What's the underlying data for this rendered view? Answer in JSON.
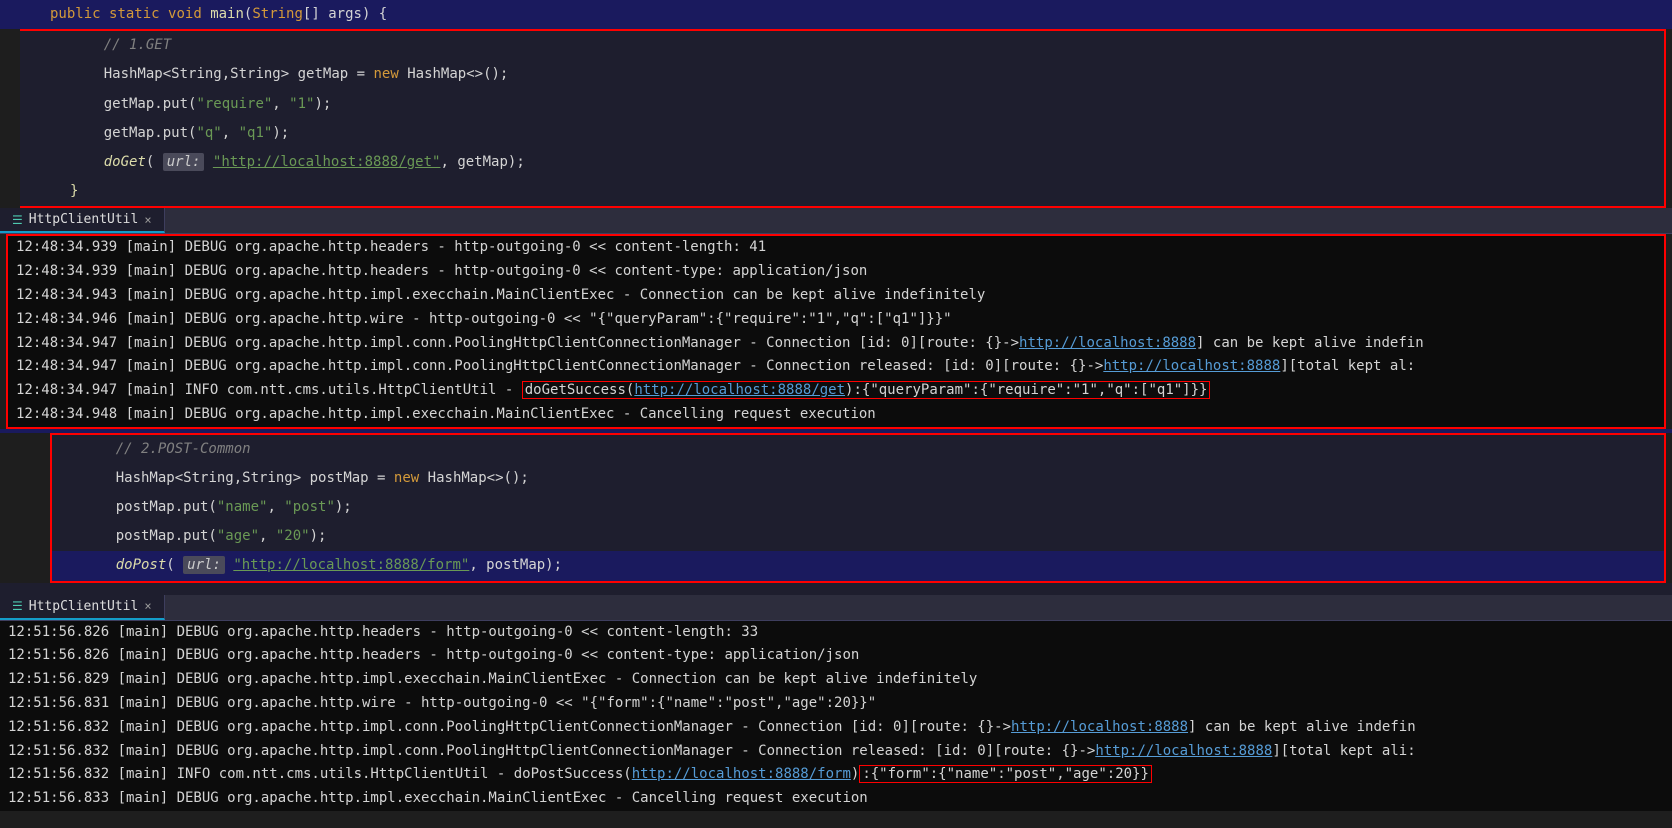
{
  "labels": {
    "get": "GET",
    "postCommon": "POST-common"
  },
  "tabs": {
    "tab1": "HttpClientUtil",
    "tab2": "HttpClientUtil"
  },
  "code": {
    "sig_public": "public",
    "sig_static": "static",
    "sig_void": "void",
    "sig_main": "main",
    "sig_string": "String",
    "sig_args": "[] args",
    "comment_get": "// 1.GET",
    "type_hashmap": "HashMap",
    "type_generics": "<String,String>",
    "var_getmap": "getMap",
    "kw_new": "new",
    "hashmap_ctor": "HashMap<>();",
    "put_require_key": "\"require\"",
    "put_require_val": "\"1\"",
    "put_q_key": "\"q\"",
    "put_q_val": "\"q1\"",
    "doget": "doGet",
    "url_label": "url:",
    "url_get": "\"http://localhost:8888/get\"",
    "comment_post": "// 2.POST-Common",
    "var_postmap": "postMap",
    "put_name_key": "\"name\"",
    "put_name_val": "\"post\"",
    "put_age_key": "\"age\"",
    "put_age_val": "\"20\"",
    "dopost": "doPost",
    "url_post": "\"http://localhost:8888/form\""
  },
  "console1": {
    "l1": "12:48:34.939 [main] DEBUG org.apache.http.headers - http-outgoing-0 << content-length: 41",
    "l2": "12:48:34.939 [main] DEBUG org.apache.http.headers - http-outgoing-0 << content-type: application/json",
    "l3": "12:48:34.943 [main] DEBUG org.apache.http.impl.execchain.MainClientExec - Connection can be kept alive indefinitely",
    "l4": "12:48:34.946 [main] DEBUG org.apache.http.wire - http-outgoing-0 << \"{\"queryParam\":{\"require\":\"1\",\"q\":[\"q1\"]}}\"",
    "l5a": "12:48:34.947 [main] DEBUG org.apache.http.impl.conn.PoolingHttpClientConnectionManager - Connection [id: 0][route: {}->",
    "l5link": "http://localhost:8888",
    "l5b": "] can be kept alive indefin",
    "l6a": "12:48:34.947 [main] DEBUG org.apache.http.impl.conn.PoolingHttpClientConnectionManager - Connection released: [id: 0][route: {}->",
    "l6link": "http://localhost:8888",
    "l6b": "][total kept al:",
    "l7a": "12:48:34.947 [main] INFO com.ntt.cms.utils.HttpClientUtil - ",
    "l7hb_a": "doGetSuccess(",
    "l7hb_link": "http://localhost:8888/get",
    "l7hb_b": "):{\"queryParam\":{\"require\":\"1\",\"q\":[\"q1\"]}}",
    "l8": "12:48:34.948 [main] DEBUG org.apache.http.impl.execchain.MainClientExec - Cancelling request execution"
  },
  "console2": {
    "l1": "12:51:56.826 [main] DEBUG org.apache.http.headers - http-outgoing-0 << content-length: 33",
    "l2": "12:51:56.826 [main] DEBUG org.apache.http.headers - http-outgoing-0 << content-type: application/json",
    "l3": "12:51:56.829 [main] DEBUG org.apache.http.impl.execchain.MainClientExec - Connection can be kept alive indefinitely",
    "l4": "12:51:56.831 [main] DEBUG org.apache.http.wire - http-outgoing-0 << \"{\"form\":{\"name\":\"post\",\"age\":20}}\"",
    "l5a": "12:51:56.832 [main] DEBUG org.apache.http.impl.conn.PoolingHttpClientConnectionManager - Connection [id: 0][route: {}->",
    "l5link": "http://localhost:8888",
    "l5b": "] can be kept alive indefin",
    "l6a": "12:51:56.832 [main] DEBUG org.apache.http.impl.conn.PoolingHttpClientConnectionManager - Connection released: [id: 0][route: {}->",
    "l6link": "http://localhost:8888",
    "l6b": "][total kept ali:",
    "l7a": "12:51:56.832 [main] INFO com.ntt.cms.utils.HttpClientUtil - doPostSuccess(",
    "l7link": "http://localhost:8888/form",
    "l7b": ")",
    "l7hb": ":{\"form\":{\"name\":\"post\",\"age\":20}}",
    "l8": "12:51:56.833 [main] DEBUG org.apache.http.impl.execchain.MainClientExec - Cancelling request execution"
  }
}
